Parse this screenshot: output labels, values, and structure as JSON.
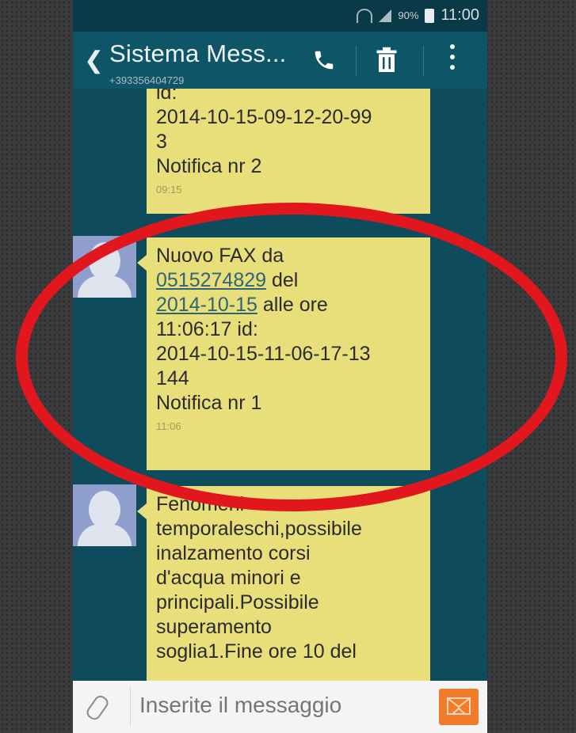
{
  "status": {
    "battery": "90%",
    "time": "11:00"
  },
  "header": {
    "title": "Sistema Mess...",
    "subtitle": "+393356404729"
  },
  "messages": [
    {
      "lines": [
        "id:",
        "2014-10-15-09-12-20-99",
        "3",
        "Notifica nr 2"
      ],
      "time": "09:15"
    },
    {
      "line1": "Nuovo FAX da",
      "line2_link": "0515274829",
      "line2_rest": " del",
      "line3_link": "2014-10-15",
      "line3_rest": " alle ore",
      "lines": [
        "11:06:17 id:",
        "2014-10-15-11-06-17-13",
        "144",
        "Notifica nr 1"
      ],
      "time": "11:06"
    },
    {
      "lines": [
        "Fenomeni",
        "temporaleschi,possibile",
        "inalzamento corsi",
        "d'acqua minori e",
        "principali.Possibile",
        "superamento",
        "soglia1.Fine ore 10 del"
      ]
    }
  ],
  "composer": {
    "placeholder": "Inserite il messaggio"
  },
  "colors": {
    "annotation": "#e1171d",
    "bubble": "#e8df7a",
    "thread": "#0e4b5d",
    "send": "#f07b2a"
  }
}
